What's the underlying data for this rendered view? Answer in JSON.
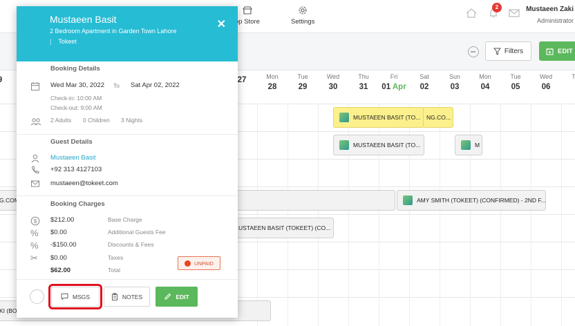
{
  "nav": {
    "items": [
      {
        "label": "pp Store",
        "icon": "store-icon"
      },
      {
        "label": "Settings",
        "icon": "gear-icon"
      }
    ],
    "notification_count": "2",
    "user_name": "Mustaeen Zaki",
    "user_role": "Administrator"
  },
  "toolbar": {
    "filters_label": "Filters",
    "edit_label": "EDIT"
  },
  "calendar": {
    "days": [
      {
        "name": "",
        "date": "9"
      },
      {
        "name": "",
        "date": "27"
      },
      {
        "name": "Mon",
        "date": "28"
      },
      {
        "name": "Tue",
        "date": "29"
      },
      {
        "name": "Wed",
        "date": "30"
      },
      {
        "name": "Thu",
        "date": "31"
      },
      {
        "name": "Fri",
        "date": "01",
        "month": "Apr"
      },
      {
        "name": "Sat",
        "date": "02"
      },
      {
        "name": "Sun",
        "date": "03"
      },
      {
        "name": "Mon",
        "date": "04"
      },
      {
        "name": "Tue",
        "date": "05"
      },
      {
        "name": "Wed",
        "date": "06"
      },
      {
        "name": "T",
        "date": ""
      }
    ],
    "bookings": [
      {
        "label": "MUSTAEEN BASIT (TO...",
        "style": "yellow",
        "thumb": true
      },
      {
        "label": "NG.CO...",
        "style": "yellow",
        "thumb": false
      },
      {
        "label": "MUSTAEEN BASIT (TO...",
        "style": "grey",
        "thumb": true
      },
      {
        "label": "M",
        "style": "grey",
        "thumb": true
      },
      {
        "label": "G.COM",
        "style": "grey",
        "thumb": false
      },
      {
        "label": "AMY SMITH (TOKEET) (CONFIRMED) - 2ND F...",
        "style": "grey",
        "thumb": true
      },
      {
        "label": "USTAEEN BASIT (TOKEET) (CO...",
        "style": "grey",
        "thumb": false
      },
      {
        "label": "KI (BO",
        "style": "grey",
        "thumb": false
      }
    ]
  },
  "popup": {
    "guest_name": "Mustaeen Basit",
    "property": "2 Bedroom Apartment in Garden Town Lahore",
    "channel": "Tokeet",
    "booking_details_title": "Booking Details",
    "arrive": "Wed Mar 30, 2022",
    "to_label": "To",
    "depart": "Sat Apr 02, 2022",
    "checkin": "Check-in: 10:00 AM",
    "checkout": "Check-out: 9:00 AM",
    "adults": "2 Adults",
    "children": "0 Children",
    "nights": "3 Nights",
    "guest_details_title": "Guest Details",
    "guest_link": "Mustaeen Basit",
    "phone": "+92 313 4127103",
    "email": "mustaeen@tokeet.com",
    "charges_title": "Booking Charges",
    "charges": [
      {
        "amount": "$212.00",
        "label": "Base Charge",
        "icon": "dollar-icon"
      },
      {
        "amount": "$0.00",
        "label": "Additional Guests Fee",
        "icon": "percent-icon"
      },
      {
        "amount": "-$150.00",
        "label": "Discounts & Fees",
        "icon": "percent-icon"
      },
      {
        "amount": "$0.00",
        "label": "Taxes",
        "icon": "scissors-icon"
      },
      {
        "amount": "$62.00",
        "label": "Total",
        "icon": ""
      }
    ],
    "status": "UNPAID",
    "buttons": {
      "msgs": "MSGS",
      "notes": "NOTES",
      "edit": "EDIT"
    }
  }
}
